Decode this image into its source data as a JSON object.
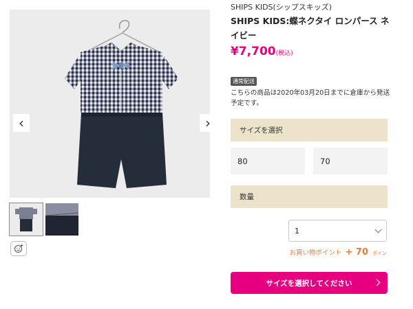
{
  "gallery": {
    "prev_icon": "chevron-left-icon",
    "next_icon": "chevron-right-icon",
    "thumbnails": [
      "front-view",
      "fabric-detail"
    ],
    "face_icon": "smiley-add-icon"
  },
  "product": {
    "brand": "SHIPS KIDS(シップスキッズ)",
    "title": "SHIPS KIDS:蝶ネクタイ ロンパース ネイビー",
    "price": "¥7,700",
    "price_tax": "(税込)",
    "shipping_badge": "通常配送",
    "shipping_note": "こちらの商品は2020年03月20日までに倉庫から発送予定です。"
  },
  "size": {
    "header": "サイズを選択",
    "options": [
      "80",
      "70"
    ]
  },
  "quantity": {
    "header": "数量",
    "selected": "1"
  },
  "points": {
    "label": "お買い物ポイント",
    "plus": "+",
    "value": "70",
    "unit": "ポイン"
  },
  "cart_button": {
    "label": "サイズを選択してください"
  },
  "colors": {
    "accent": "#e6007f",
    "section_bg": "#ede3ca",
    "points": "#f07a33"
  }
}
